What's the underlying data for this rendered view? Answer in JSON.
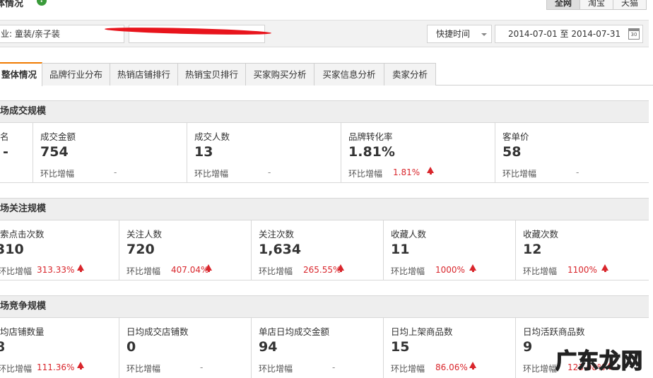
{
  "header": {
    "title": "体情况",
    "help_glyph": "?"
  },
  "scope_tabs": [
    {
      "label": "全网",
      "active": true
    },
    {
      "label": "淘宝",
      "active": false
    },
    {
      "label": "天猫",
      "active": false
    }
  ],
  "filters": {
    "industry": "业: 童装/亲子装",
    "quick_time": "快捷时间",
    "date_range": "2014-07-01 至 2014-07-31",
    "calendar_glyph": "30"
  },
  "tabs": [
    {
      "label": "整体情况",
      "active": true
    },
    {
      "label": "品牌行业分布"
    },
    {
      "label": "热销店铺排行"
    },
    {
      "label": "热销宝贝排行"
    },
    {
      "label": "买家购买分析"
    },
    {
      "label": "买家信息分析"
    },
    {
      "label": "卖家分析"
    }
  ],
  "sections": {
    "trade": {
      "title": "场成交规模",
      "metrics": [
        {
          "label": "名",
          "value": "-",
          "change_label": "",
          "change_value": ""
        },
        {
          "label": "成交金额",
          "value": "754",
          "change_label": "环比增幅",
          "change_value": "-"
        },
        {
          "label": "成交人数",
          "value": "13",
          "change_label": "环比增幅",
          "change_value": "-"
        },
        {
          "label": "品牌转化率",
          "value": "1.81%",
          "change_label": "环比增幅",
          "change_value": "1.81%"
        },
        {
          "label": "客单价",
          "value": "58",
          "change_label": "环比增幅",
          "change_value": "-"
        }
      ]
    },
    "attention": {
      "title": "场关注规模",
      "metrics": [
        {
          "label": "索点击次数",
          "value": "310",
          "change_label": "环比增幅",
          "change_value": "313.33%"
        },
        {
          "label": "关注人数",
          "value": "720",
          "change_label": "环比增幅",
          "change_value": "407.04%"
        },
        {
          "label": "关注次数",
          "value": "1,634",
          "change_label": "环比增幅",
          "change_value": "265.55%"
        },
        {
          "label": "收藏人数",
          "value": "11",
          "change_label": "环比增幅",
          "change_value": "1000%"
        },
        {
          "label": "收藏次数",
          "value": "12",
          "change_label": "环比增幅",
          "change_value": "1100%"
        }
      ]
    },
    "competition": {
      "title": "场竞争规模",
      "metrics": [
        {
          "label": "均店铺数量",
          "value": "8",
          "change_label": "环比增幅",
          "change_value": "111.36%"
        },
        {
          "label": "日均成交店铺数",
          "value": "0",
          "change_label": "环比增幅",
          "change_value": "-"
        },
        {
          "label": "单店日均成交金额",
          "value": "94",
          "change_label": "环比增幅",
          "change_value": "-"
        },
        {
          "label": "日均上架商品数",
          "value": "15",
          "change_label": "环比增幅",
          "change_value": "86.06%"
        },
        {
          "label": "日均活跃商品数",
          "value": "9",
          "change_label": "环比增幅",
          "change_value": "123.08%"
        }
      ]
    }
  },
  "watermark": "广东龙网",
  "colors": {
    "accent": "#f07a00",
    "increase": "#d9262c",
    "redaction": "#e8141c"
  }
}
